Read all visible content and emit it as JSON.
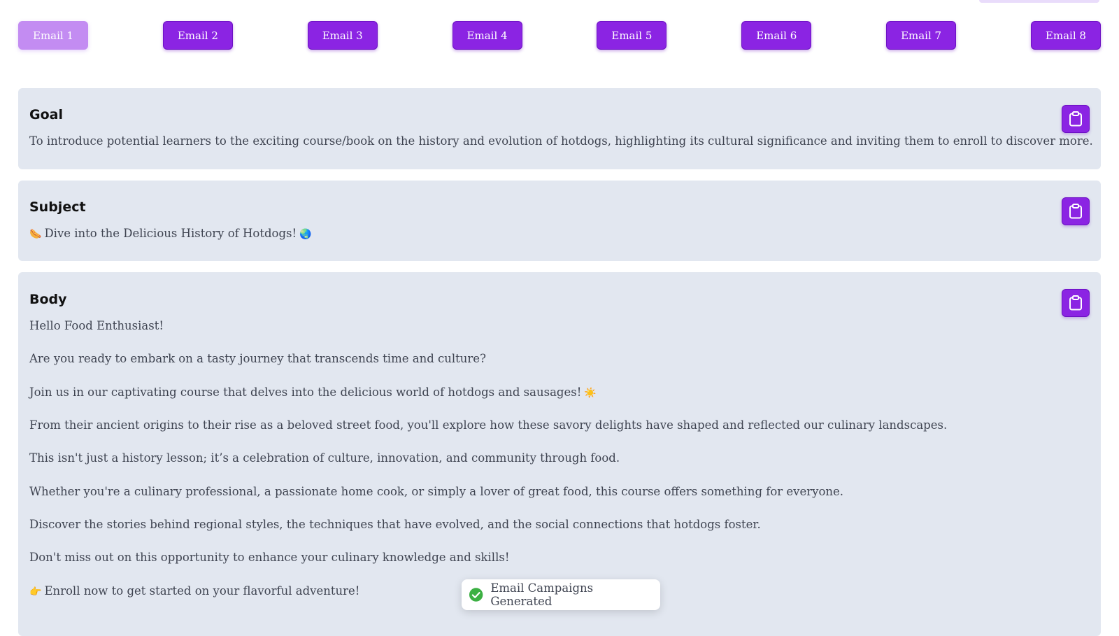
{
  "tabs": [
    "Email 1",
    "Email 2",
    "Email 3",
    "Email 4",
    "Email 5",
    "Email 6",
    "Email 7",
    "Email 8"
  ],
  "active_tab": "Email 1",
  "goal": {
    "title": "Goal",
    "text": "To introduce potential learners to the exciting course/book on the history and evolution of hotdogs, highlighting its cultural significance and inviting them to enroll to discover more."
  },
  "subject": {
    "title": "Subject",
    "emoji_start": "🌭",
    "text": "Dive into the Delicious History of Hotdogs!",
    "emoji_end": "🌏"
  },
  "body": {
    "title": "Body",
    "lines": [
      "Hello Food Enthusiast!",
      "Are you ready to embark on a tasty journey that transcends time and culture?",
      "Join us in our captivating course that delves into the delicious world of hotdogs and sausages!",
      "From their ancient origins to their rise as a beloved street food, you'll explore how these savory delights have shaped and reflected our culinary landscapes.",
      "This isn't just a history lesson; it’s a celebration of culture, innovation, and community through food.",
      "Whether you're a culinary professional, a passionate home cook, or simply a lover of great food, this course offers something for everyone.",
      "Discover the stories behind regional styles, the techniques that have evolved, and the social connections that hotdogs foster.",
      "Don't miss out on this opportunity to enhance your culinary knowledge and skills!",
      "Enroll now to get started on your flavorful adventure!"
    ],
    "line2_emoji": "☀️",
    "last_emoji": "👉"
  },
  "toast": {
    "text": "Email Campaigns Generated"
  },
  "colors": {
    "accent": "#8b24e3",
    "accent_active": "#c38cf2",
    "card_bg": "#e2e7f0",
    "success": "#3cb043"
  },
  "icons": {
    "copy": "clipboard-icon",
    "toast": "check-circle-icon"
  }
}
